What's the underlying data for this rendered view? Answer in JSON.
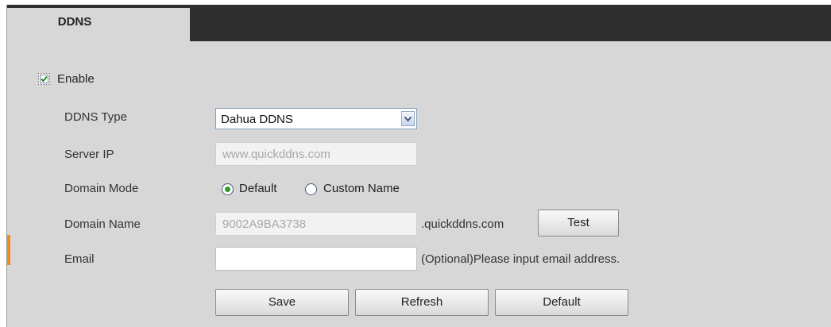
{
  "tab": {
    "label": "DDNS"
  },
  "enable": {
    "label": "Enable",
    "checked": true
  },
  "fields": {
    "ddns_type": {
      "label": "DDNS Type",
      "value": "Dahua DDNS"
    },
    "server_ip": {
      "label": "Server IP",
      "value": "www.quickddns.com"
    },
    "domain_mode": {
      "label": "Domain Mode",
      "options": {
        "default": "Default",
        "custom": "Custom Name"
      },
      "selected": "Default"
    },
    "domain_name": {
      "label": "Domain Name",
      "value": "9002A9BA3738",
      "suffix": ".quickddns.com"
    },
    "email": {
      "label": "Email",
      "value": "",
      "note": "(Optional)Please input email address."
    }
  },
  "buttons": {
    "test": "Test",
    "save": "Save",
    "refresh": "Refresh",
    "default": "Default"
  },
  "colors": {
    "accent": "#f08a1c",
    "radio_selected": "#2e9a2e",
    "tab_bar": "#2e2e2e",
    "panel": "#d7d7d7"
  }
}
